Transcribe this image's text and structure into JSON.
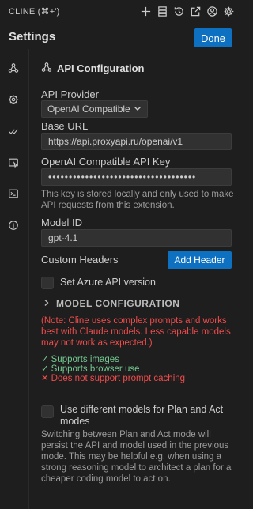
{
  "window": {
    "title": "CLINE (⌘+')"
  },
  "toolbar": {
    "icons": [
      "plus-icon",
      "stack-icon",
      "history-icon",
      "open-external-icon",
      "account-icon",
      "settings-icon"
    ]
  },
  "header": {
    "title": "Settings",
    "done_label": "Done"
  },
  "sidebar": {
    "icons": [
      "api-icon",
      "gear-icon",
      "check-icon",
      "browser-icon",
      "terminal-icon",
      "info-icon"
    ]
  },
  "section": {
    "title": "API Configuration"
  },
  "api_provider": {
    "label": "API Provider",
    "selected": "OpenAI Compatible"
  },
  "base_url": {
    "label": "Base URL",
    "value": "https://api.proxyapi.ru/openai/v1"
  },
  "api_key": {
    "label": "OpenAI Compatible API Key",
    "value": "••••••••••••••••••••••••••••••••••••",
    "help": "This key is stored locally and only used to make API requests from this extension."
  },
  "model_id": {
    "label": "Model ID",
    "value": "gpt-4.1"
  },
  "custom_headers": {
    "label": "Custom Headers",
    "add_label": "Add Header"
  },
  "azure": {
    "label": "Set Azure API version"
  },
  "model_config": {
    "label": "MODEL CONFIGURATION"
  },
  "warning": "(Note: Cline uses complex prompts and works best with Claude models. Less capable models may not work as expected.)",
  "capabilities": [
    {
      "mark": "✓",
      "text": "Supports images",
      "status": "ok"
    },
    {
      "mark": "✓",
      "text": "Supports browser use",
      "status": "ok"
    },
    {
      "mark": "✕",
      "text": "Does not support prompt caching",
      "status": "bad"
    }
  ],
  "plan_act": {
    "label": "Use different models for Plan and Act modes",
    "help": "Switching between Plan and Act mode will persist the API and model used in the previous mode. This may be helpful e.g. when using a strong reasoning model to architect a plan for a cheaper coding model to act on."
  },
  "colors": {
    "accent": "#0e70c0",
    "error": "#f14c4c",
    "success": "#73c991",
    "background": "#1e1e1e"
  }
}
